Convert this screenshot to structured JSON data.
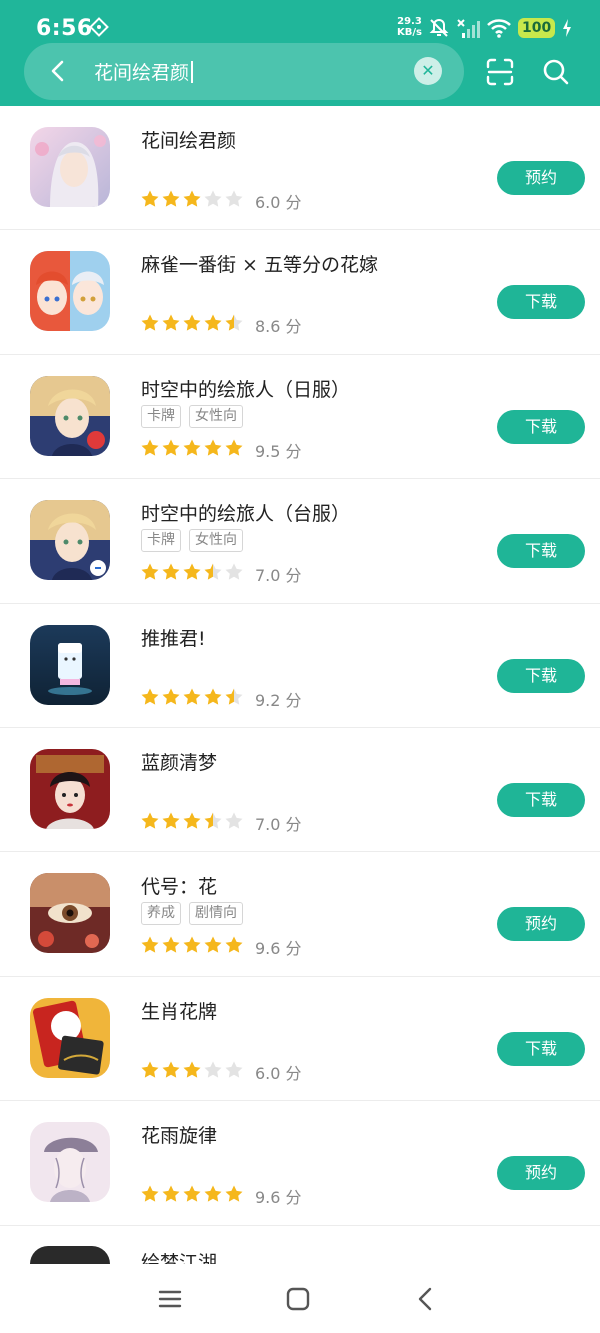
{
  "status": {
    "time": "6:56",
    "net_speed_value": "29.3",
    "net_speed_unit": "KB/s",
    "battery": "100"
  },
  "search": {
    "query": "花间绘君颜"
  },
  "apps": [
    {
      "name": "花间绘君颜",
      "tags": [],
      "stars": 3,
      "score": "6.0 分",
      "action": "预约",
      "icon": "app-icon-huajian"
    },
    {
      "name": "麻雀一番街 × 五等分の花嫁",
      "tags": [],
      "stars": 4.5,
      "score": "8.6 分",
      "action": "下载",
      "icon": "app-icon-mahjong"
    },
    {
      "name": "时空中的绘旅人（日服）",
      "tags": [
        "卡牌",
        "女性向"
      ],
      "stars": 5,
      "score": "9.5 分",
      "action": "下载",
      "icon": "app-icon-painter-jp"
    },
    {
      "name": "时空中的绘旅人（台服）",
      "tags": [
        "卡牌",
        "女性向"
      ],
      "stars": 3.5,
      "score": "7.0 分",
      "action": "下载",
      "icon": "app-icon-painter-tw"
    },
    {
      "name": "推推君!",
      "tags": [],
      "stars": 4.5,
      "score": "9.2 分",
      "action": "下载",
      "icon": "app-icon-tuitui"
    },
    {
      "name": "蓝颜清梦",
      "tags": [],
      "stars": 3.5,
      "score": "7.0 分",
      "action": "下载",
      "icon": "app-icon-lanyan"
    },
    {
      "name": "代号：花",
      "tags": [
        "养成",
        "剧情向"
      ],
      "stars": 5,
      "score": "9.6 分",
      "action": "预约",
      "icon": "app-icon-codename-hua"
    },
    {
      "name": "生肖花牌",
      "tags": [],
      "stars": 3,
      "score": "6.0 分",
      "action": "下载",
      "icon": "app-icon-hanafuda"
    },
    {
      "name": "花雨旋律",
      "tags": [],
      "stars": 5,
      "score": "9.6 分",
      "action": "预约",
      "icon": "app-icon-huayu"
    }
  ],
  "partial_item": {
    "name": "绘梦江湖"
  },
  "colors": {
    "header": "#20b69a",
    "button": "#1fb597",
    "star_filled": "#f5b71c",
    "star_empty": "#e3e3e3"
  }
}
